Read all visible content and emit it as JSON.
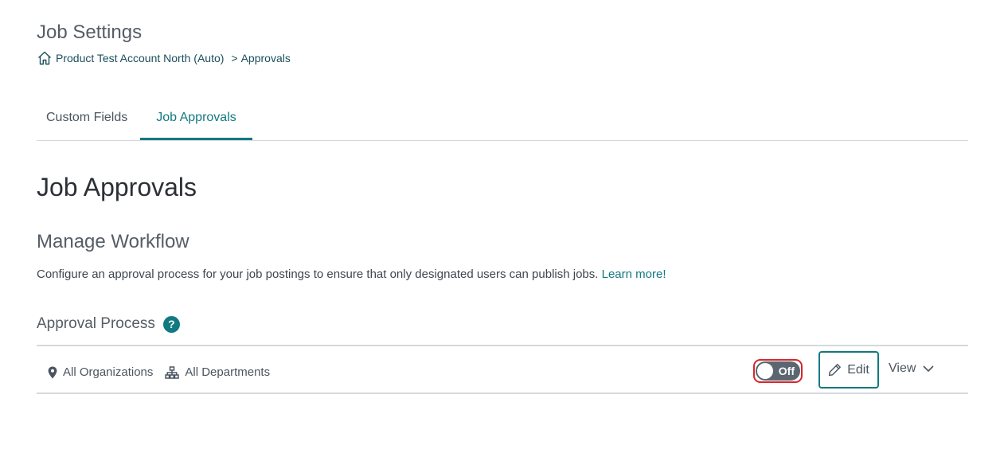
{
  "header": {
    "title": "Job Settings",
    "breadcrumb": {
      "home_icon": "home-icon",
      "account": "Product Test Account North (Auto)",
      "separator": ">",
      "current": "Approvals"
    }
  },
  "tabs": [
    {
      "label": "Custom Fields",
      "active": false
    },
    {
      "label": "Job Approvals",
      "active": true
    }
  ],
  "main": {
    "section_title": "Job Approvals",
    "sub_title": "Manage Workflow",
    "description": "Configure an approval process for your job postings to ensure that only designated users can publish jobs.",
    "learn_more": "Learn more!",
    "approval_process": {
      "label": "Approval Process",
      "help_icon": "?",
      "organizations": "All Organizations",
      "departments": "All Departments",
      "toggle_state": "Off",
      "edit_label": "Edit",
      "view_label": "View"
    }
  },
  "colors": {
    "accent": "#117a80",
    "focus_ring": "#d7262b",
    "toggle_off": "#5b6670"
  }
}
